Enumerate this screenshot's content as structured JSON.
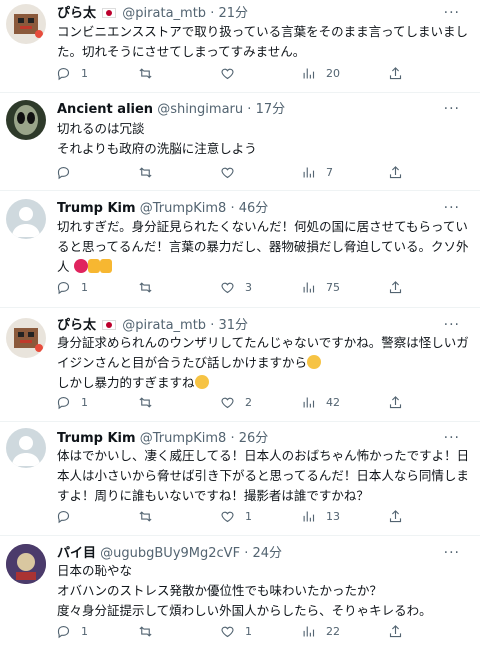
{
  "tweets": [
    {
      "name": "ぴら太",
      "handle": "@pirata_mtb",
      "time": "21分",
      "lines": [
        "コンビニエンスストアで取り扱っている言葉をそのまま言ってしまいまし",
        "た。切れそうにさせてしまってすみません。"
      ],
      "replies": "1",
      "retweets": "",
      "likes": "",
      "views": "20",
      "flag": true
    },
    {
      "name": "Ancient alien",
      "handle": "@shingimaru",
      "time": "17分",
      "lines": [
        "切れるのは冗談",
        "それよりも政府の洗脳に注意しよう"
      ],
      "replies": "",
      "retweets": "",
      "likes": "",
      "views": "7"
    },
    {
      "name": "Trump Kim",
      "handle": "@TrumpKim8",
      "time": "46分",
      "lines": [
        "切れすぎだ。身分証見られたくないんだ！何処の国に居させてもらってい",
        "ると思ってるんだ！言葉の暴力だし、器物破損だし脅迫している。クソ外",
        "人"
      ],
      "replies": "1",
      "retweets": "",
      "likes": "3",
      "views": "75"
    },
    {
      "name": "ぴら太",
      "handle": "@pirata_mtb",
      "time": "31分",
      "lines": [
        "身分証求められんのウンザリしてたんじゃないですかね。警察は怪しいガ",
        "イジンさんと目が合うたび話しかけますから",
        "しかし暴力的すぎますね"
      ],
      "replies": "1",
      "retweets": "",
      "likes": "2",
      "views": "42",
      "flag": true
    },
    {
      "name": "Trump Kim",
      "handle": "@TrumpKim8",
      "time": "26分",
      "lines": [
        "体はでかいし、凄く威圧してる！日本人のおばちゃん怖かったですよ！日",
        "本人は小さいから脅せば引き下がると思ってるんだ！日本人なら同情しま",
        "すよ！周りに誰もいないですね！撮影者は誰ですかね？"
      ],
      "replies": "",
      "retweets": "",
      "likes": "1",
      "views": "13"
    },
    {
      "name": "パイ目",
      "handle": "@ugubgBUy9Mg2cVF",
      "time": "24分",
      "lines": [
        "日本の恥やな",
        "オバハンのストレス発散か優位性でも味わいたかったか？",
        "度々身分証提示して煩わしい外国人からしたら、そりゃキレるわ。"
      ],
      "replies": "1",
      "retweets": "",
      "likes": "1",
      "views": "22"
    }
  ],
  "more_label": "···",
  "colors": {
    "text": "#0f1419",
    "secondary": "#536471",
    "divider": "#eff3f4"
  }
}
